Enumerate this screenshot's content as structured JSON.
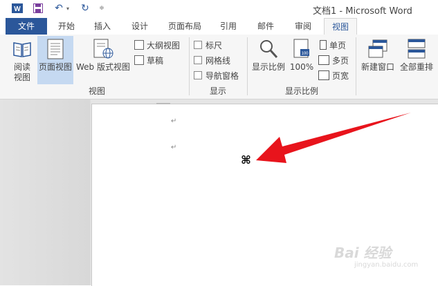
{
  "window": {
    "title": "文档1 - Microsoft Word"
  },
  "tabs": [
    {
      "label": "文件"
    },
    {
      "label": "开始"
    },
    {
      "label": "插入"
    },
    {
      "label": "设计"
    },
    {
      "label": "页面布局"
    },
    {
      "label": "引用"
    },
    {
      "label": "邮件"
    },
    {
      "label": "审阅"
    },
    {
      "label": "视图"
    }
  ],
  "ribbon": {
    "views": {
      "read_mode": "阅读\n视图",
      "print_layout": "页面视图",
      "web_layout": "Web 版式视图",
      "outline": "大纲视图",
      "draft": "草稿",
      "group_label": "视图"
    },
    "show": {
      "ruler": "标尺",
      "gridlines": "网格线",
      "nav_pane": "导航窗格",
      "group_label": "显示"
    },
    "zoom": {
      "zoom": "显示比例",
      "hundred": "100%",
      "one_page": "单页",
      "multi_page": "多页",
      "page_width": "页宽",
      "group_label": "显示比例"
    },
    "window": {
      "new_window": "新建窗口",
      "arrange_all": "全部重排"
    }
  },
  "document": {
    "para_mark": "↵",
    "cursor_glyph": "⌘"
  },
  "watermark": {
    "main": "Bai 经验",
    "sub": "jingyan.baidu.com"
  },
  "colors": {
    "accent": "#2b579a",
    "arrow": "#e8141c",
    "selected_button": "#c5d9f1"
  }
}
